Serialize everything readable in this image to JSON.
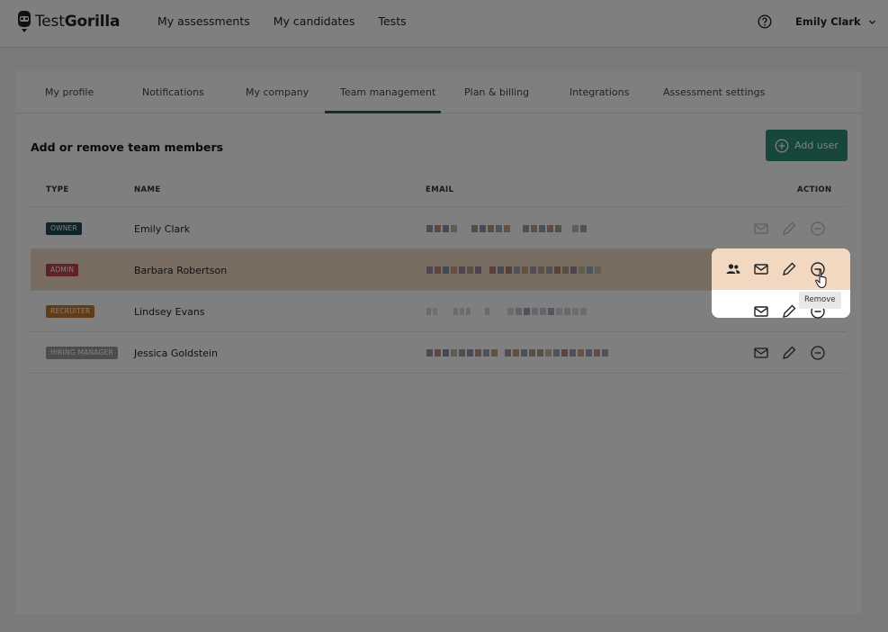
{
  "brand": {
    "name_light": "Test",
    "name_bold": "Gorilla"
  },
  "nav": [
    {
      "label": "My assessments"
    },
    {
      "label": "My candidates"
    },
    {
      "label": "Tests"
    }
  ],
  "user": {
    "name": "Emily Clark"
  },
  "tabs": [
    {
      "label": "My profile"
    },
    {
      "label": "Notifications"
    },
    {
      "label": "My company"
    },
    {
      "label": "Team management",
      "active": true
    },
    {
      "label": "Plan & billing"
    },
    {
      "label": "Integrations"
    },
    {
      "label": "Assessment settings"
    }
  ],
  "section": {
    "title": "Add or remove team members",
    "add_user": "Add user"
  },
  "table": {
    "headers": {
      "type": "TYPE",
      "name": "NAME",
      "email": "EMAIL",
      "action": "ACTION"
    },
    "rows": [
      {
        "type": "OWNER",
        "type_color": "#1f4b55",
        "name": "Emily Clark"
      },
      {
        "type": "ADMIN",
        "type_color": "#c0444e",
        "name": "Barbara Robertson",
        "highlighted": true
      },
      {
        "type": "RECRUITER",
        "type_color": "#c07a30",
        "name": "Lindsey Evans"
      },
      {
        "type": "HIRING MANAGER",
        "type_color": "#9a9a9a",
        "name": "Jessica Goldstein"
      }
    ]
  },
  "tooltip": {
    "label": "Remove"
  },
  "colors": {
    "accent": "#2f8c77",
    "tab_underline": "#1e5f5a",
    "highlight_row": "#f3d8c1"
  }
}
